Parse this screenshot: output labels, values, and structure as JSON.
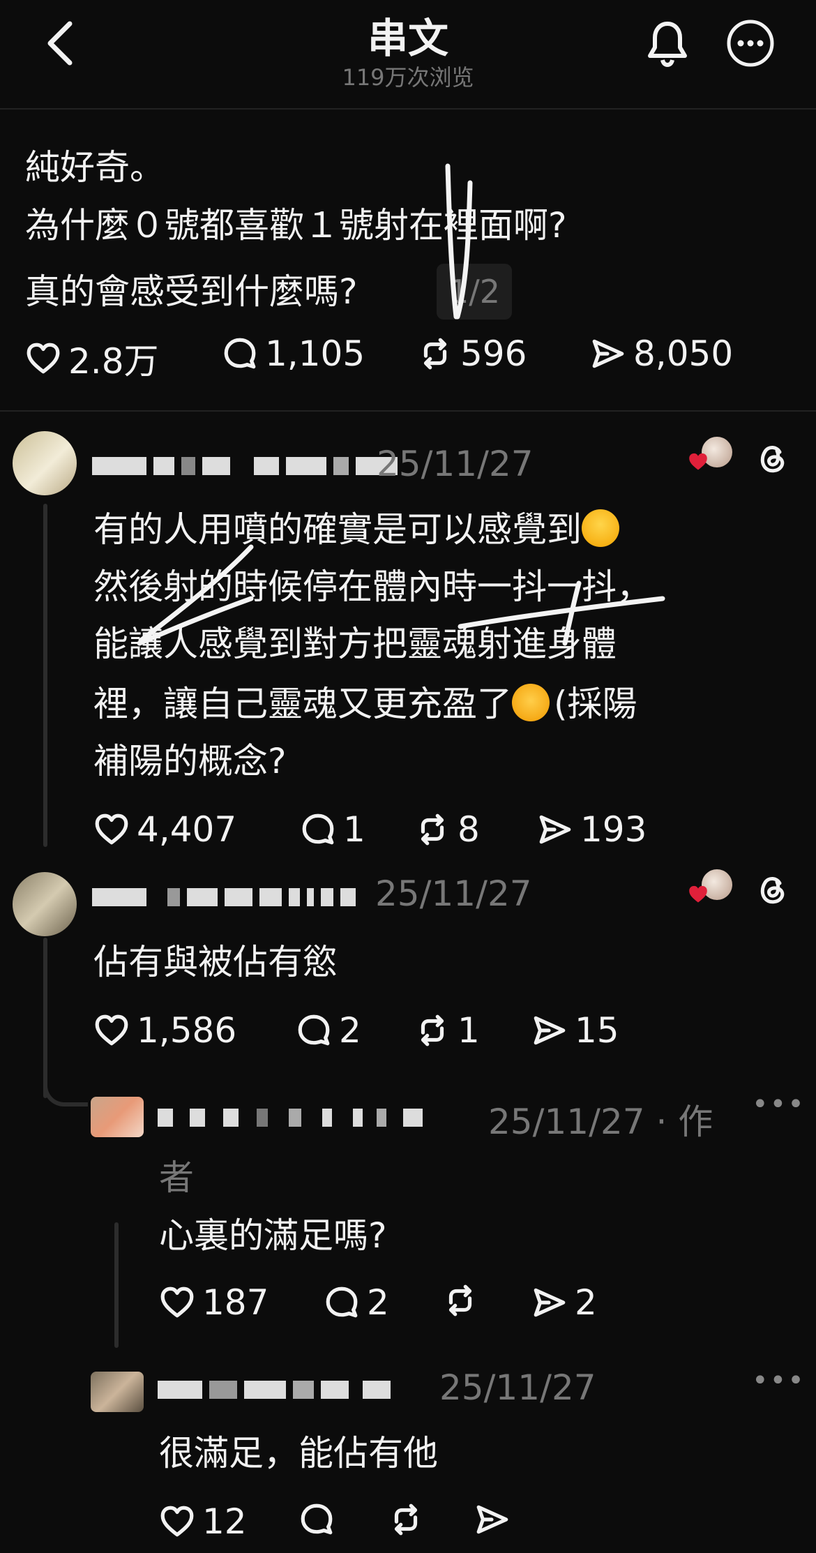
{
  "header": {
    "title": "串文",
    "views": "119万次浏览"
  },
  "post": {
    "lines": [
      "純好奇。",
      "為什麼０號都喜歡１號射在裡面啊?",
      "真的會感受到什麼嗎?"
    ],
    "page_indicator": "1/2",
    "stats": {
      "likes": "2.8万",
      "comments": "1,105",
      "reposts": "596",
      "shares": "8,050"
    }
  },
  "comments": [
    {
      "date": "25/11/27",
      "lines": [
        "有的人用噴的確實是可以感覺到",
        "然後射的時候停在體內時一抖一抖，",
        "能讓人感覺到對方把靈魂射進身體",
        "裡，讓自己靈魂又更充盈了",
        "(採陽",
        "補陽的概念?"
      ],
      "stats": {
        "likes": "4,407",
        "comments": "1",
        "reposts": "8",
        "shares": "193"
      }
    },
    {
      "date": "25/11/27",
      "lines": [
        "佔有與被佔有慾"
      ],
      "stats": {
        "likes": "1,586",
        "comments": "2",
        "reposts": "1",
        "shares": "15"
      }
    },
    {
      "date": "25/11/27",
      "author_tag": "· 作",
      "author_tag2": "者",
      "lines": [
        "心裏的滿足嗎?"
      ],
      "stats": {
        "likes": "187",
        "comments": "2",
        "reposts": "",
        "shares": "2"
      }
    },
    {
      "date": "25/11/27",
      "lines": [
        "很滿足，能佔有他"
      ],
      "stats": {
        "likes": "12",
        "comments": "",
        "reposts": "",
        "shares": ""
      }
    }
  ],
  "colors": {
    "background": "#0c0c0c",
    "text": "#f2f2f2",
    "muted": "#777777",
    "heart_badge": "#e0203a"
  }
}
